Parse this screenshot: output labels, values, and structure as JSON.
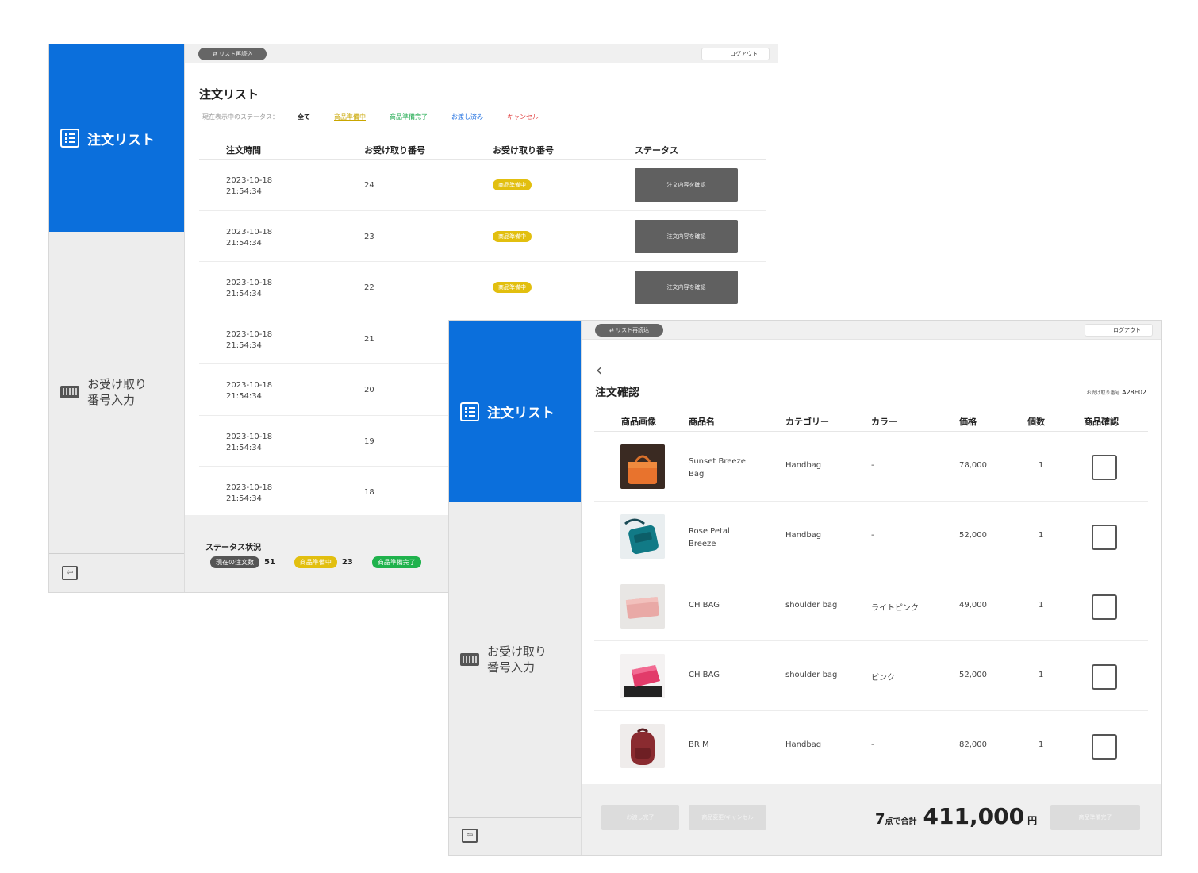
{
  "sidebar": {
    "order_list_label": "注文リスト",
    "pickup_input_label": "お受け取り\n番号入力"
  },
  "topbar": {
    "reload_label": "⇄ リスト再読込",
    "logout_label": "ログアウト"
  },
  "order_list": {
    "title": "注文リスト",
    "filter_label": "現在表示中のステータス：",
    "filters": [
      "全て",
      "商品準備中",
      "商品準備完了",
      "お渡し済み",
      "キャンセル"
    ],
    "columns": [
      "注文時間",
      "お受け取り番号",
      "お受け取り番号",
      "ステータス"
    ],
    "confirm_label": "注文内容を確認",
    "rows": [
      {
        "time": "2023-10-18\n21:54:34",
        "number": "24",
        "status": "商品準備中"
      },
      {
        "time": "2023-10-18\n21:54:34",
        "number": "23",
        "status": "商品準備中"
      },
      {
        "time": "2023-10-18\n21:54:34",
        "number": "22",
        "status": "商品準備中"
      },
      {
        "time": "2023-10-18\n21:54:34",
        "number": "21"
      },
      {
        "time": "2023-10-18\n21:54:34",
        "number": "20"
      },
      {
        "time": "2023-10-18\n21:54:34",
        "number": "19"
      },
      {
        "time": "2023-10-18\n21:54:34",
        "number": "18"
      }
    ],
    "status_summary": {
      "title": "ステータス状況",
      "current_label": "現在の注文数",
      "current_count": "51",
      "preparing_label": "商品準備中",
      "preparing_count": "23",
      "done_label": "商品準備完了"
    }
  },
  "order_detail": {
    "title": "注文確認",
    "ticket_label": "お受け取り番号",
    "ticket_value": "A28E02",
    "columns": [
      "商品画像",
      "商品名",
      "カテゴリー",
      "カラー",
      "価格",
      "個数",
      "商品確認"
    ],
    "items": [
      {
        "image": "orange-handbag",
        "name": "Sunset Breeze\nBag",
        "category": "Handbag",
        "color": "-",
        "price": "78,000",
        "qty": "1"
      },
      {
        "image": "teal-backpack",
        "name": "Rose Petal\nBreeze",
        "category": "Handbag",
        "color": "-",
        "price": "52,000",
        "qty": "1"
      },
      {
        "image": "pink-clutch",
        "name": "CH BAG",
        "category": "shoulder bag",
        "color": "ライトピンク",
        "price": "49,000",
        "qty": "1"
      },
      {
        "image": "pink-shoulder-bag",
        "name": "CH BAG",
        "category": "shoulder bag",
        "color": "ピンク",
        "price": "52,000",
        "qty": "1"
      },
      {
        "image": "burgundy-backpack",
        "name": "BR M",
        "category": "Handbag",
        "color": "-",
        "price": "82,000",
        "qty": "1"
      }
    ],
    "footer": {
      "btn_hand_over": "お渡し完了",
      "btn_cancel_change": "商品変更/キャンセル",
      "total_count": "7",
      "total_count_label": "点で合計",
      "total_amount": "411,000",
      "currency": "円",
      "btn_prepared": "商品準備完了"
    }
  },
  "colors": {
    "brand_blue": "#0b6fdc",
    "preparing_yellow": "#e2bf0f",
    "done_green": "#1fb24c",
    "handed_blue": "#1f6fe0",
    "cancel_red": "#e03c3c"
  }
}
